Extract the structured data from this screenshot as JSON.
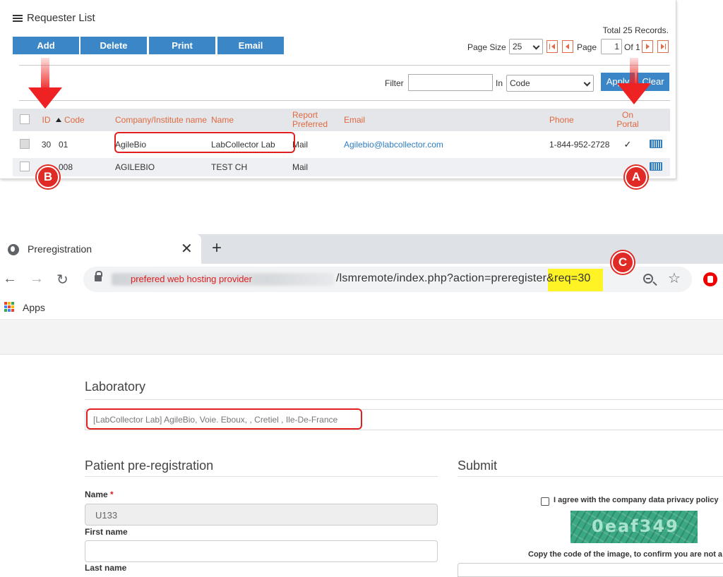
{
  "requester_list": {
    "title": "Requester List",
    "toolbar": {
      "add": "Add",
      "delete": "Delete",
      "print": "Print",
      "email": "Email"
    },
    "total_records": "Total 25 Records.",
    "pager": {
      "page_size_label": "Page Size",
      "page_size_value": "25",
      "page_label": "Page",
      "page_value": "1",
      "of_label": "Of 1"
    },
    "filter": {
      "label": "Filter",
      "value": "",
      "in_label": "In",
      "field_value": "Code",
      "apply": "Apply",
      "clear": "Clear"
    },
    "columns": {
      "id": "ID",
      "code": "Code",
      "company": "Company/Institute name",
      "name": "Name",
      "report": "Report Preferred",
      "email": "Email",
      "phone": "Phone",
      "on_portal": "On Portal"
    },
    "rows": [
      {
        "id": "30",
        "code": "01",
        "company": "AgileBio",
        "name": "LabCollector Lab",
        "report": "Mail",
        "email": "Agilebio@labcollector.com",
        "phone": "1-844-952-2728",
        "on_portal": "✓"
      },
      {
        "id": "",
        "code": "008",
        "company": "AGILEBIO",
        "name": "TEST CH",
        "report": "Mail",
        "email": "",
        "phone": "",
        "on_portal": ""
      }
    ],
    "annotations": {
      "a": "A",
      "b": "B"
    }
  },
  "browser": {
    "tab_title": "Preregistration",
    "tab_close": "✕",
    "new_tab": "+",
    "nav": {
      "back": "←",
      "forward": "→",
      "reload": "↻"
    },
    "url_note": "prefered web hosting provider",
    "url_path": "/lsmremote/index.php?action=preregister&req=30",
    "url_annotation": "C",
    "star": "☆",
    "bookmarks_apps": "Apps"
  },
  "page": {
    "laboratory_title": "Laboratory",
    "laboratory_value": "[LabCollector Lab] AgileBio, Voie. Eboux, , Cretiel , Ile-De-France",
    "patient_title": "Patient pre-registration",
    "name_label": "Name",
    "required_mark": "*",
    "name_value": "U133",
    "first_name_label": "First name",
    "first_name_value": "",
    "last_name_label": "Last name",
    "submit_title": "Submit",
    "agree_text": "I agree with the company data privacy policy",
    "captcha_code": "0eaf349",
    "captcha_hint": "Copy the code of the image, to confirm you are not a r"
  },
  "colors": {
    "button_blue": "#3b86c7",
    "header_orange": "#e0693f",
    "annotation_red": "#e02a25",
    "highlight_yellow": "#fff200",
    "link_blue": "#2d7dc2"
  }
}
